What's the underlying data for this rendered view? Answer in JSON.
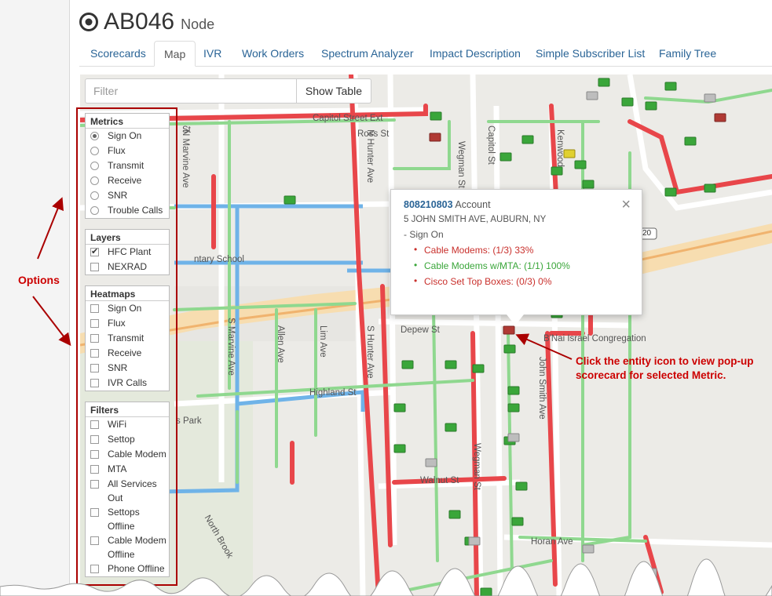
{
  "header": {
    "title": "AB046",
    "subtitle": "Node",
    "icon": "target-icon"
  },
  "tabs": [
    {
      "label": "Scorecards",
      "active": false
    },
    {
      "label": "Map",
      "active": true
    },
    {
      "label": "IVR",
      "active": false
    },
    {
      "label": "Work Orders",
      "active": false
    },
    {
      "label": "Spectrum Analyzer",
      "active": false
    },
    {
      "label": "Impact Description",
      "active": false
    },
    {
      "label": "Simple Subscriber List",
      "active": false
    },
    {
      "label": "Family Tree",
      "active": false
    }
  ],
  "filter": {
    "placeholder": "Filter",
    "show_table_label": "Show Table"
  },
  "metrics": {
    "title": "Metrics",
    "options": [
      "Sign On",
      "Flux",
      "Transmit",
      "Receive",
      "SNR",
      "Trouble Calls"
    ],
    "selected": "Sign On"
  },
  "layers": {
    "title": "Layers",
    "options": [
      {
        "label": "HFC Plant",
        "checked": true
      },
      {
        "label": "NEXRAD",
        "checked": false
      }
    ]
  },
  "heatmaps": {
    "title": "Heatmaps",
    "options": [
      "Sign On",
      "Flux",
      "Transmit",
      "Receive",
      "SNR",
      "IVR Calls"
    ]
  },
  "filters": {
    "title": "Filters",
    "options": [
      {
        "line1": "WiFi",
        "line2": ""
      },
      {
        "line1": "Settop",
        "line2": ""
      },
      {
        "line1": "Cable Modem",
        "line2": ""
      },
      {
        "line1": "MTA",
        "line2": ""
      },
      {
        "line1": "All Services",
        "line2": "Out"
      },
      {
        "line1": "Settops",
        "line2": "Offline"
      },
      {
        "line1": "Cable Modem",
        "line2": "Offline"
      },
      {
        "line1": "Phone Offline",
        "line2": ""
      }
    ]
  },
  "options_callout": "Options",
  "popup": {
    "account_number": "808210803",
    "account_label": "Account",
    "address": "5 JOHN SMITH AVE, AUBURN, NY",
    "metric": "- Sign On",
    "items": [
      {
        "text": "Cable Modems: (1/3) 33%",
        "color": "#c9302c"
      },
      {
        "text": "Cable Modems w/MTA: (1/1) 100%",
        "color": "#3aa63a"
      },
      {
        "text": "Cisco Set Top Boxes: (0/3) 0%",
        "color": "#c9302c"
      }
    ],
    "close": "×"
  },
  "annotation": "Click the entity icon to view pop-up scorecard for selected Metric.",
  "map_labels": {
    "capitol_ext": "Capitol Street Ext",
    "n_marvine": "N Marvine Ave",
    "n_hunter": "N Hunter Ave",
    "ross": "Ross St",
    "capitol_st": "Capitol St",
    "kenwood": "Kenwood",
    "wegman": "Wegman St",
    "school": "ntary School",
    "depew": "Depew St",
    "bnai": "B'Nai Israel Congregation",
    "s_marvine": "S Marvine Ave",
    "allen": "Allen Ave",
    "lim": "Lim Ave",
    "s_hunter": "S Hunter Ave",
    "highland": "Highland St",
    "john_smith": "John Smith Ave",
    "park": "s Park",
    "walnut": "Walnut St",
    "north_brook": "North Brook",
    "horan": "Horan Ave",
    "st": "St",
    "shield": "20"
  },
  "colors": {
    "accent": "#2a6496",
    "alert": "#c00000",
    "good": "#3aa63a",
    "bad": "#c9302c",
    "plant_red": "#e8464a",
    "plant_green": "#8fd88f",
    "plant_blue": "#6fb3e8"
  }
}
